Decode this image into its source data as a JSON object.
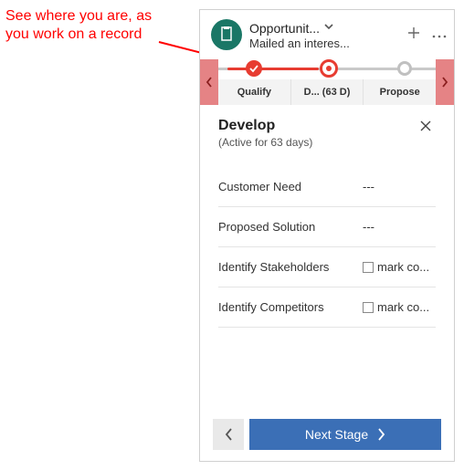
{
  "annotation": "See where you are, as\nyou work on a record",
  "header": {
    "title": "Opportunit...",
    "subtitle": "Mailed an interes..."
  },
  "process": {
    "stages": [
      {
        "label": "Qualify"
      },
      {
        "label": "D...  (63 D)"
      },
      {
        "label": "Propose"
      }
    ]
  },
  "detail": {
    "title": "Develop",
    "subtitle": "(Active for 63 days)",
    "fields": [
      {
        "label": "Customer Need",
        "value": "---",
        "type": "text"
      },
      {
        "label": "Proposed Solution",
        "value": "---",
        "type": "text"
      },
      {
        "label": "Identify Stakeholders",
        "value": "mark co...",
        "type": "check"
      },
      {
        "label": "Identify Competitors",
        "value": "mark co...",
        "type": "check"
      }
    ]
  },
  "footer": {
    "next_label": "Next Stage"
  }
}
